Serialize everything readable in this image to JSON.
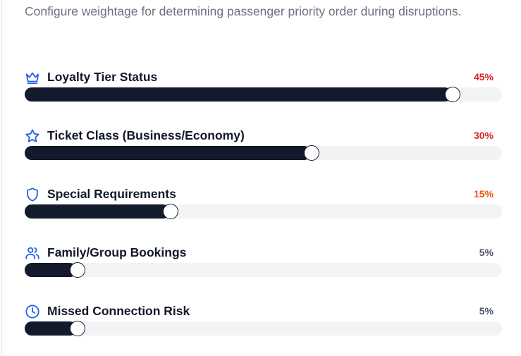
{
  "description": "Configure weightage for determining passenger priority order during disruptions.",
  "colors": {
    "accent": "#2563eb",
    "high": "#dc2626",
    "medium": "#ea580c",
    "low": "#4b5563",
    "fill": "#121a2c",
    "track": "#f1f3f5"
  },
  "factors": [
    {
      "icon": "crown-icon",
      "label": "Loyalty Tier Status",
      "percent_label": "45%",
      "level": 0.895
    },
    {
      "icon": "star-icon",
      "label": "Ticket Class (Business/Economy)",
      "percent_label": "30%",
      "level": 0.6
    },
    {
      "icon": "shield-icon",
      "label": "Special Requirements",
      "percent_label": "15%",
      "level": 0.305
    },
    {
      "icon": "users-icon",
      "label": "Family/Group Bookings",
      "percent_label": "5%",
      "level": 0.11
    },
    {
      "icon": "clock-icon",
      "label": "Missed Connection Risk",
      "percent_label": "5%",
      "level": 0.11
    }
  ]
}
